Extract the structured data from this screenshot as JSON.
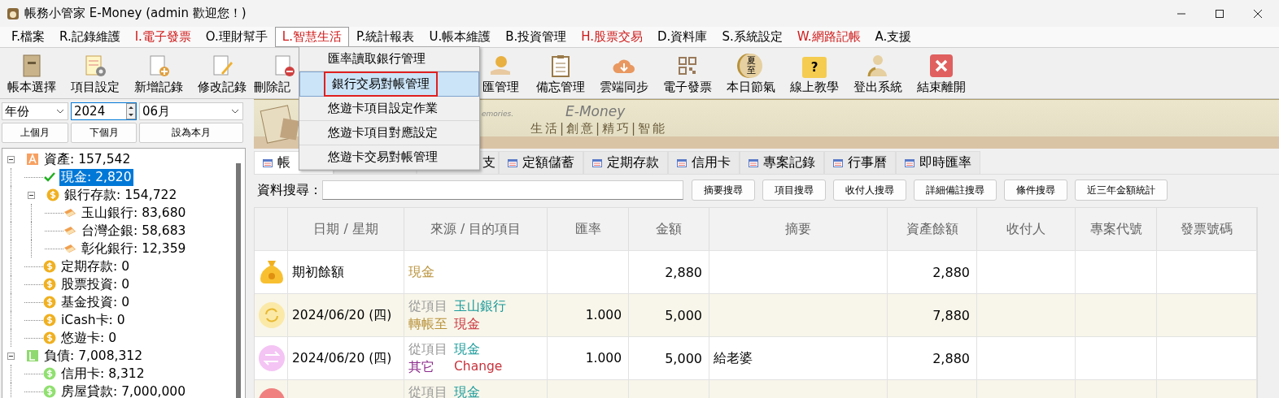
{
  "window": {
    "title": "帳務小管家 E-Money (admin 歡迎您！)"
  },
  "menu": [
    {
      "label": "F.檔案",
      "color": "#000000",
      "selected": false
    },
    {
      "label": "R.記錄維護",
      "color": "#000000",
      "selected": false
    },
    {
      "label": "I.電子發票",
      "color": "#d01818",
      "selected": false
    },
    {
      "label": "O.理財幫手",
      "color": "#000000",
      "selected": false
    },
    {
      "label": "L.智慧生活",
      "color": "#d01818",
      "selected": true
    },
    {
      "label": "P.統計報表",
      "color": "#000000",
      "selected": false
    },
    {
      "label": "U.帳本維護",
      "color": "#000000",
      "selected": false
    },
    {
      "label": "B.投資管理",
      "color": "#000000",
      "selected": false
    },
    {
      "label": "H.股票交易",
      "color": "#d01818",
      "selected": false
    },
    {
      "label": "D.資料庫",
      "color": "#000000",
      "selected": false
    },
    {
      "label": "S.系統設定",
      "color": "#000000",
      "selected": false
    },
    {
      "label": "W.網路記帳",
      "color": "#d01818",
      "selected": false
    },
    {
      "label": "A.支援",
      "color": "#000000",
      "selected": false
    }
  ],
  "dropdown": [
    {
      "label": "匯率讀取銀行管理",
      "selected": false
    },
    {
      "label": "銀行交易對帳管理",
      "selected": true
    },
    {
      "label": "悠遊卡項目設定作業",
      "selected": false
    },
    {
      "label": "悠遊卡項目對應設定",
      "selected": false
    },
    {
      "label": "悠遊卡交易對帳管理",
      "selected": false
    }
  ],
  "toolbar": [
    {
      "label": "帳本選擇",
      "kind": "book"
    },
    {
      "label": "項目設定",
      "kind": "settings"
    },
    {
      "label": "新增記錄",
      "kind": "add"
    },
    {
      "label": "修改記錄",
      "kind": "edit"
    },
    {
      "label": "刪除記",
      "kind": "delete"
    },
    {
      "label": "匯管理",
      "kind": "exchange"
    },
    {
      "label": "備忘管理",
      "kind": "memo"
    },
    {
      "label": "雲端同步",
      "kind": "sync"
    },
    {
      "label": "電子發票",
      "kind": "invoice"
    },
    {
      "label": "本日節氣",
      "kind": "season",
      "icon_text": "夏至"
    },
    {
      "label": "線上教學",
      "kind": "help",
      "icon_text": "?"
    },
    {
      "label": "登出系統",
      "kind": "logout"
    },
    {
      "label": "結束離開",
      "kind": "exit"
    }
  ],
  "filters": {
    "period": "年份",
    "year": "2024",
    "month": "06月"
  },
  "nav_buttons": [
    "上個月",
    "下個月",
    "設為本月"
  ],
  "tree": [
    {
      "label": "資產: 157,542",
      "kind": "asset",
      "expanded": true,
      "selected": false,
      "children": [
        {
          "label": "現金: 2,820",
          "kind": "current",
          "selected": true
        },
        {
          "label": "銀行存款: 154,722",
          "kind": "account",
          "expanded": true,
          "selected": false,
          "children": [
            {
              "label": "玉山銀行: 83,680",
              "kind": "bank",
              "selected": false
            },
            {
              "label": "台灣企銀: 58,683",
              "kind": "bank",
              "selected": false
            },
            {
              "label": "彰化銀行: 12,359",
              "kind": "bank",
              "selected": false
            }
          ]
        },
        {
          "label": "定期存款: 0",
          "kind": "account",
          "selected": false
        },
        {
          "label": "股票投資: 0",
          "kind": "account",
          "selected": false
        },
        {
          "label": "基金投資: 0",
          "kind": "account",
          "selected": false
        },
        {
          "label": "iCash卡: 0",
          "kind": "account",
          "selected": false
        },
        {
          "label": "悠遊卡: 0",
          "kind": "account",
          "selected": false
        }
      ]
    },
    {
      "label": "負債: 7,008,312",
      "kind": "liability",
      "expanded": true,
      "selected": false,
      "children": [
        {
          "label": "信用卡: 8,312",
          "kind": "debt",
          "selected": false
        },
        {
          "label": "房屋貸款: 7,000,000",
          "kind": "debt",
          "selected": false
        }
      ]
    }
  ],
  "banner": {
    "tagline_fragment": "emories.",
    "brand": "E-Money",
    "slogan": "生活|創意|精巧|智能"
  },
  "tabs": [
    {
      "label": "帳",
      "selected": true
    },
    {
      "selected": false
    },
    {
      "label": "支",
      "selected": false
    },
    {
      "label": "定額儲蓄",
      "selected": false
    },
    {
      "label": "定期存款",
      "selected": false
    },
    {
      "label": "信用卡",
      "selected": false
    },
    {
      "label": "專案記錄",
      "selected": false
    },
    {
      "label": "行事曆",
      "selected": false
    },
    {
      "label": "即時匯率",
      "selected": false
    }
  ],
  "search": {
    "label": "資料搜尋：",
    "buttons": [
      "摘要搜尋",
      "項目搜尋",
      "收付人搜尋",
      "詳細備註搜尋",
      "條件搜尋",
      "近三年金額統計"
    ]
  },
  "table": {
    "columns": [
      "日期 / 星期",
      "來源 / 目的項目",
      "匯率",
      "金額",
      "摘要",
      "資產餘額",
      "收付人",
      "專案代號",
      "發票號碼"
    ],
    "rows": [
      {
        "kind": "opening",
        "date": "期初餘額",
        "source": [
          [
            {
              "text": "現金",
              "color": "#b8923a"
            }
          ]
        ],
        "amount": "2,880",
        "balance": "2,880"
      },
      {
        "kind": "transfer",
        "date": "2024/06/20 (四)",
        "source": [
          [
            {
              "text": "從項目",
              "color": "#9a9a9a"
            },
            {
              "text": "玉山銀行",
              "color": "#1a9a9a"
            }
          ],
          [
            {
              "text": "轉帳至",
              "color": "#b8923a"
            },
            {
              "text": "現金",
              "color": "#c8323c"
            }
          ]
        ],
        "rate": "1.000",
        "amount": "5,000",
        "balance": "7,880"
      },
      {
        "kind": "other",
        "date": "2024/06/20 (四)",
        "source": [
          [
            {
              "text": "從項目",
              "color": "#9a9a9a"
            },
            {
              "text": "現金",
              "color": "#1a9a9a"
            }
          ],
          [
            {
              "text": "其它",
              "color": "#8b2a8b"
            },
            {
              "text": "Change",
              "color": "#c8323c"
            }
          ]
        ],
        "rate": "1.000",
        "amount": "5,000",
        "summary": "給老婆",
        "balance": "2,880"
      },
      {
        "kind": "expense",
        "source": [
          [
            {
              "text": "從項目",
              "color": "#9a9a9a"
            },
            {
              "text": "現金",
              "color": "#1a9a9a"
            }
          ]
        ]
      }
    ]
  }
}
